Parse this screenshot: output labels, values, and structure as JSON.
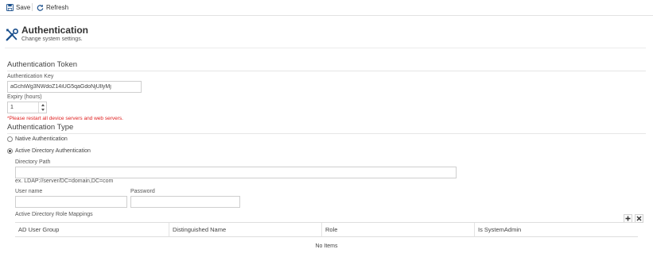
{
  "toolbar": {
    "save_label": "Save",
    "refresh_label": "Refresh"
  },
  "header": {
    "title": "Authentication",
    "subtitle": "Change system settings."
  },
  "token_section": {
    "title": "Authentication Token",
    "key_label": "Authentication Key",
    "key_value": "aGchiWg3NWdoZ14iUG5qaGdoNjUllyMj",
    "expiry_label": "Expiry (hours)",
    "expiry_value": "1",
    "warning": "*Please restart all device servers and web servers."
  },
  "type_section": {
    "title": "Authentication Type",
    "options": [
      {
        "label": "Native Authentication",
        "checked": false
      },
      {
        "label": "Active Directory Authentication",
        "checked": true
      }
    ]
  },
  "ad": {
    "directory_path_label": "Directory Path",
    "directory_path_value": "",
    "directory_path_hint": "ex. LDAP://server/DC=domain,DC=com",
    "username_label": "User name",
    "username_value": "",
    "password_label": "Password",
    "password_value": "",
    "mappings_label": "Active Directory Role Mappings",
    "add_icon": "plus-icon",
    "remove_icon": "close-icon",
    "columns": [
      "AD User Group",
      "Distinguished Name",
      "Role",
      "Is SystemAdmin"
    ],
    "empty_text": "No Items"
  }
}
